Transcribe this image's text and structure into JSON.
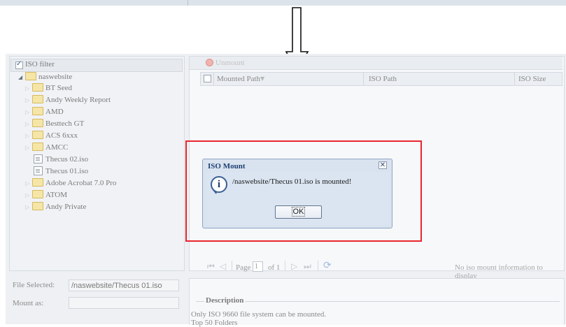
{
  "left": {
    "iso_filter_label": "ISO filter",
    "tree": [
      {
        "label": "naswebsite",
        "type": "folder"
      },
      {
        "label": "BT Seed",
        "type": "folder"
      },
      {
        "label": "Andy Weekly Report",
        "type": "folder"
      },
      {
        "label": "AMD",
        "type": "folder"
      },
      {
        "label": "Besttech GT",
        "type": "folder"
      },
      {
        "label": "ACS 6xxx",
        "type": "folder"
      },
      {
        "label": "AMCC",
        "type": "folder"
      },
      {
        "label": "Thecus 02.iso",
        "type": "file"
      },
      {
        "label": "Thecus 01.iso",
        "type": "file"
      },
      {
        "label": "Adobe Acrobat 7.0 Pro",
        "type": "folder"
      },
      {
        "label": "ATOM",
        "type": "folder"
      },
      {
        "label": "Andy Private",
        "type": "folder"
      }
    ],
    "file_selected_label": "File Selected:",
    "file_selected_value": "/naswebsite/Thecus 01.iso",
    "mount_as_label": "Mount as:"
  },
  "right": {
    "unmount_label": "Unmount",
    "columns": {
      "mounted_path": "Mounted Path",
      "iso_path": "ISO Path",
      "iso_size": "ISO Size"
    },
    "pager": {
      "page_label": "Page",
      "page_value": "1",
      "of_label": "of 1",
      "status": "No iso mount information to display"
    },
    "description": {
      "title": "Description",
      "line1": "Only ISO 9660 file system can be mounted.",
      "line2": "Top 50 Folders"
    }
  },
  "dialog": {
    "title": "ISO Mount",
    "message": "/naswebsite/Thecus 01.iso is mounted!",
    "ok_label": "OK",
    "close_glyph": "✕"
  },
  "colors": {
    "highlight": "#e8262d",
    "dialog_title": "#1d3f73"
  },
  "icons": {
    "arrow": "down-arrow-icon",
    "info": "info-icon",
    "unmount": "unmount-icon",
    "refresh": "refresh-icon"
  }
}
